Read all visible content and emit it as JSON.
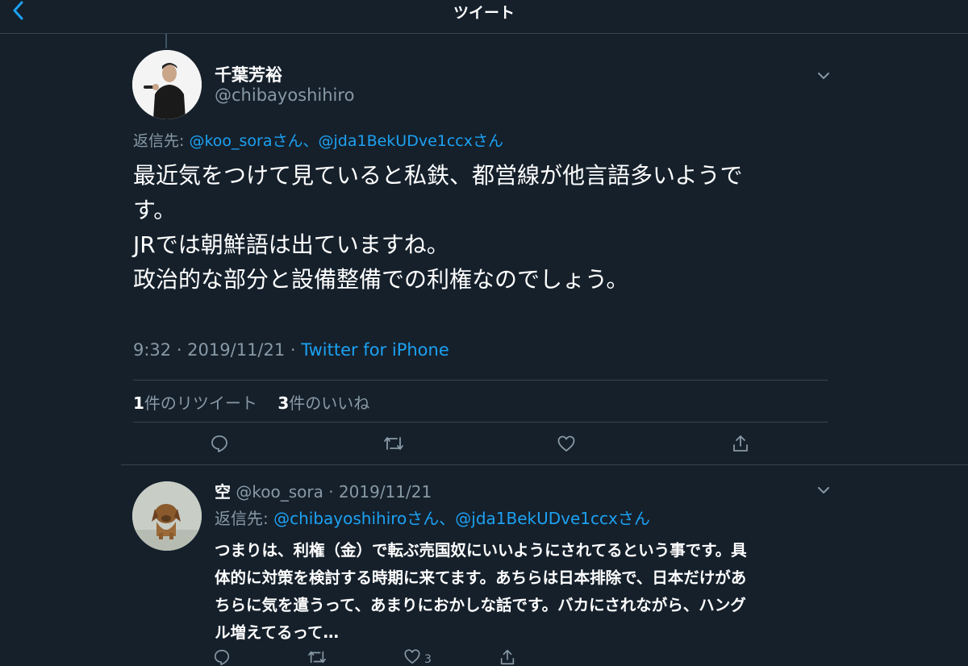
{
  "header": {
    "title": "ツイート",
    "back_icon": "chevron-left-icon"
  },
  "tweet": {
    "display_name": "千葉芳裕",
    "handle": "@chibayoshihiro",
    "reply_to_prefix": "返信先: ",
    "reply_to_mentions": "@koo_soraさん、@jda1BekUDve1ccxさん",
    "text_lines": [
      "最近気をつけて見ていると私鉄、都営線が他言語多いようで",
      "す。",
      "JRでは朝鮮語は出ていますね。",
      "政治的な部分と設備整備での利権なのでしょう。"
    ],
    "time": "9:32 · 2019/11/21 · ",
    "source": "Twitter for iPhone",
    "retweet_count": "1",
    "retweet_label": "件のリツイート",
    "like_count": "3",
    "like_label": "件のいいね"
  },
  "reply": {
    "display_name": "空",
    "handle": "@koo_sora",
    "date": "· 2019/11/21",
    "reply_to_prefix": "返信先: ",
    "reply_to_mentions": "@chibayoshihiroさん、@jda1BekUDve1ccxさん",
    "text_lines": [
      "つまりは、利権（金）で転ぶ売国奴にいいようにされてるという事です。具",
      "体的に対策を検討する時期に来てます。あちらは日本排除で、日本だけがあ",
      "ちらに気を遣うって、あまりにおかしな話です。バカにされながら、ハング",
      "ル増えてるって…"
    ],
    "like_count": "3"
  },
  "colors": {
    "background": "#15202b",
    "accent": "#1da1f2",
    "muted": "#8899a6",
    "divider": "#38444d"
  },
  "icons": {
    "reply": "comment-icon",
    "retweet": "retweet-icon",
    "like": "heart-icon",
    "share": "share-icon"
  }
}
